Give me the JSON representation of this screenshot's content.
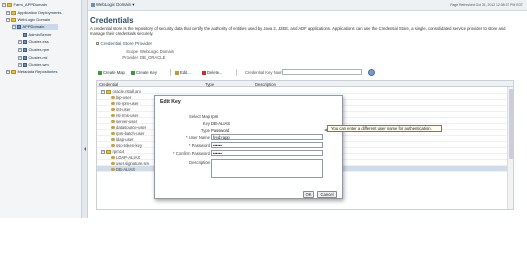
{
  "nav": {
    "items": [
      {
        "label": "Farm_APPDomain",
        "expander": "−",
        "icon": "folder-icon"
      },
      {
        "label": "Application Deployments",
        "expander": "+",
        "icon": "folder-icon"
      },
      {
        "label": "WebLogic Domain",
        "expander": "−",
        "icon": "folder-icon"
      },
      {
        "label": "APPDomain",
        "expander": "−",
        "icon": "domain-icon"
      },
      {
        "label": "AdminServer",
        "expander": "",
        "icon": "server-icon"
      },
      {
        "label": "Cluster-ess",
        "expander": "+",
        "icon": "server-icon"
      },
      {
        "label": "Cluster-rpm",
        "expander": "+",
        "icon": "server-icon"
      },
      {
        "label": "Cluster-rrd",
        "expander": "+",
        "icon": "server-icon"
      },
      {
        "label": "Cluster-wm",
        "expander": "+",
        "icon": "server-icon"
      },
      {
        "label": "Metadata Repositories",
        "expander": "+",
        "icon": "folder-icon"
      }
    ]
  },
  "topbar": {
    "domain_label": "WebLogic Domain",
    "refreshed": "Page Refreshed Oct 31, 2012 12:08:37 PM EDT"
  },
  "page": {
    "title": "Credentials",
    "description": "A credential store is the repository of security data that certify the authority of entities used by Java 2, J2EE, and ADF applications. Applications can use the Credential Store, a single, consolidated service provider to store and manage their credentials securely.",
    "section_title": "Credential Store Provider",
    "scope_label": "Scope",
    "scope_value": "WebLogic Domain",
    "provider_label": "Provider",
    "provider_value": "DB_ORACLE"
  },
  "toolbar": {
    "create_map": "Create Map",
    "create_key": "Create Key",
    "edit": "Edit...",
    "delete": "Delete...",
    "key_name_label": "Credential Key Name"
  },
  "table": {
    "columns": [
      "Credential",
      "Type",
      "Description"
    ],
    "rows": [
      {
        "name": "oracle.rstall.ani",
        "indent": 1,
        "kind": "map"
      },
      {
        "name": "bip-user",
        "indent": 2,
        "kind": "key"
      },
      {
        "name": "rsl-rpm-user",
        "indent": 2,
        "kind": "key"
      },
      {
        "name": "iSt-user",
        "indent": 2,
        "kind": "key"
      },
      {
        "name": "rsl-rms-user",
        "indent": 2,
        "kind": "key"
      },
      {
        "name": "server-user",
        "indent": 2,
        "kind": "key"
      },
      {
        "name": "datasource-user",
        "indent": 2,
        "kind": "key"
      },
      {
        "name": "rpm-batch-user",
        "indent": 2,
        "kind": "key"
      },
      {
        "name": "ldap-user",
        "indent": 2,
        "kind": "key"
      },
      {
        "name": "sso-token-key",
        "indent": 2,
        "kind": "key"
      },
      {
        "name": "rpm14",
        "indent": 1,
        "kind": "map"
      },
      {
        "name": "LDAP-ALIAS",
        "indent": 2,
        "kind": "key"
      },
      {
        "name": "user.signature.sm",
        "indent": 2,
        "kind": "key"
      },
      {
        "name": "DB-ALIAS",
        "indent": 2,
        "kind": "key",
        "selected": true
      }
    ]
  },
  "dialog": {
    "title": "Edit Key",
    "select_map_label": "Select Map",
    "select_map_value": "rpm",
    "key_label": "Key",
    "key_value": "DB-ALIAS",
    "type_label": "Type",
    "type_value": "Password",
    "username_label": "User Name",
    "username_value": "fred:rapp",
    "password_label": "Password",
    "password_value": "••••••",
    "confirm_label": "Confirm Password",
    "confirm_value": "••••••",
    "description_label": "Description",
    "required_marker": "*",
    "ok_label": "OK",
    "cancel_label": "Cancel"
  },
  "tooltip": {
    "text": "You can enter a different user name for authentication."
  }
}
